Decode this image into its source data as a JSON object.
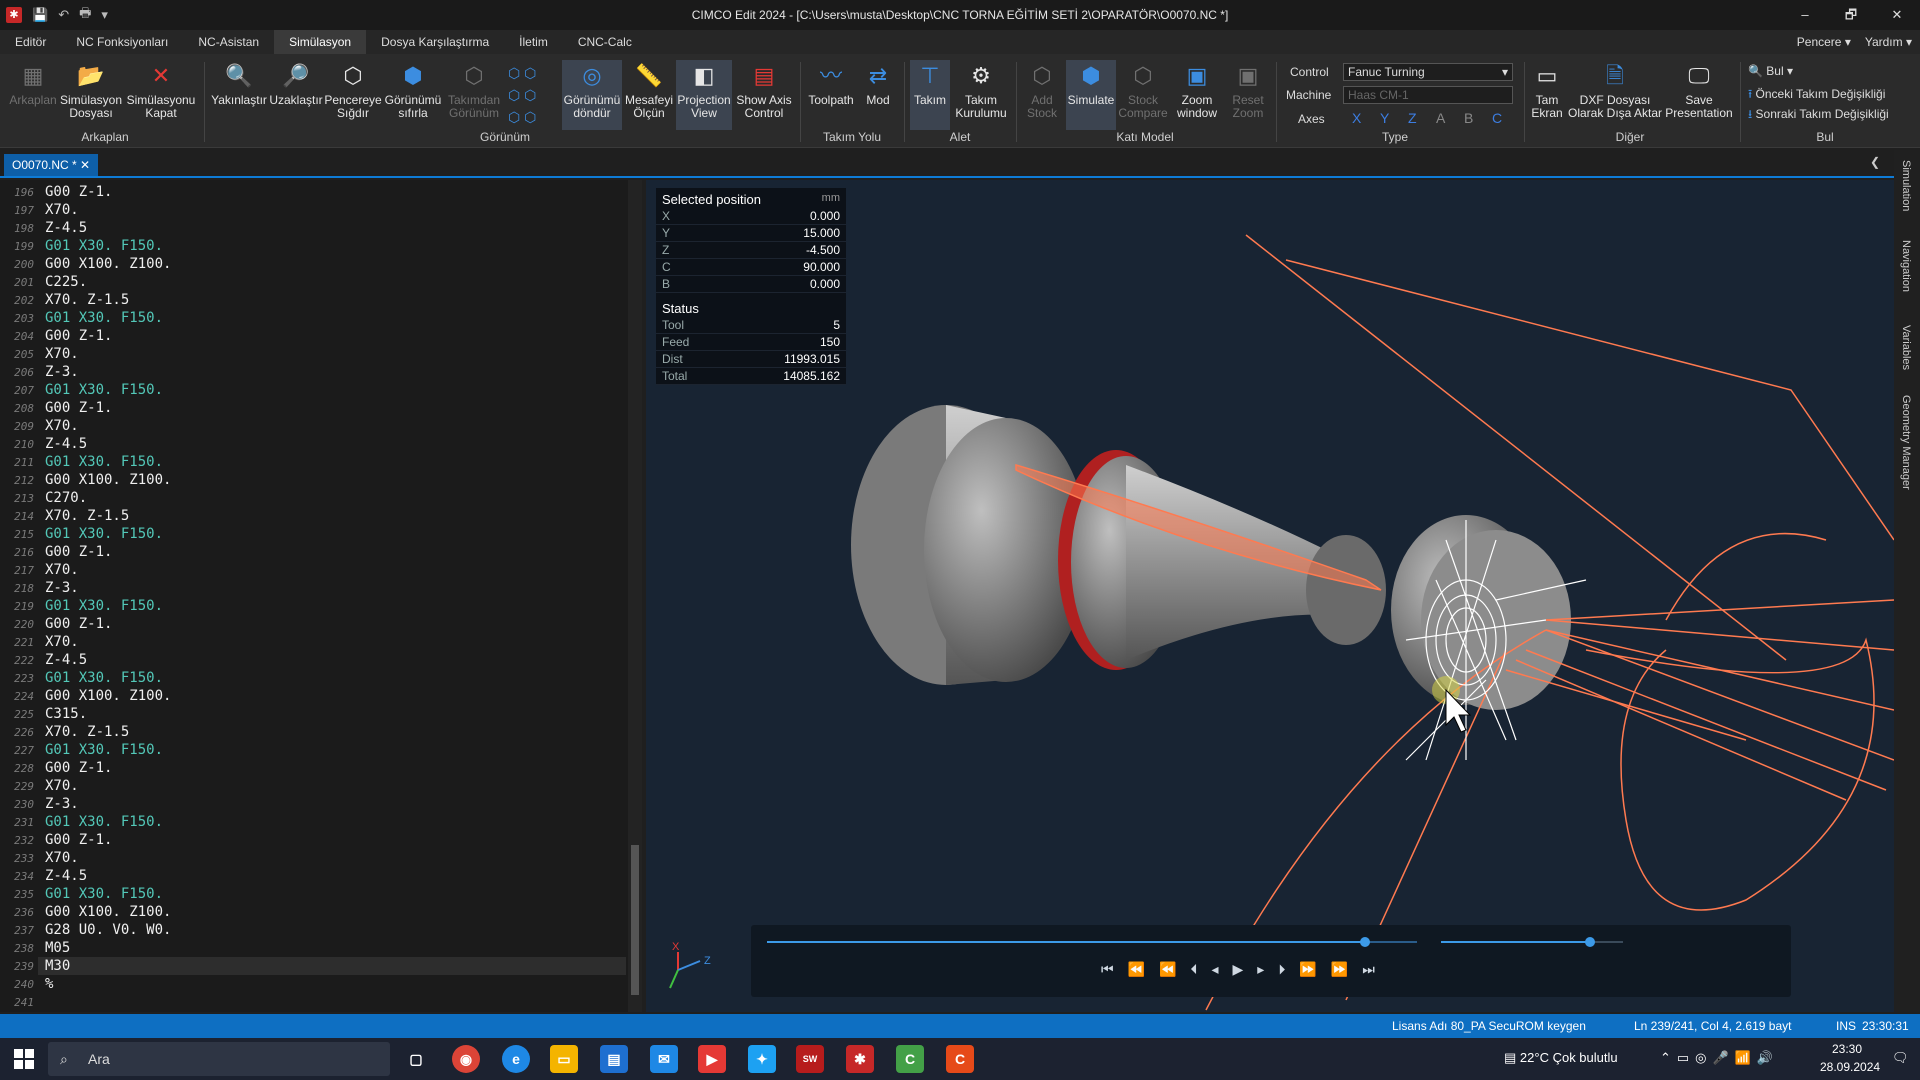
{
  "window": {
    "title": "CIMCO Edit 2024 - [C:\\Users\\musta\\Desktop\\CNC TORNA EĞİTİM SETİ 2\\OPARATÖR\\O0070.NC *]",
    "minimize": "–",
    "restore": "🗗",
    "close": "✕"
  },
  "menu": {
    "tabs": [
      "Editör",
      "NC Fonksiyonları",
      "NC-Asistan",
      "Simülasyon",
      "Dosya Karşılaştırma",
      "İletim",
      "CNC-Calc"
    ],
    "right": [
      "Pencere",
      "Yardım"
    ]
  },
  "ribbon": {
    "buttons": [
      {
        "label": "Arkaplan",
        "icon": "background-icon"
      },
      {
        "label": "Simülasyon\nDosyası",
        "icon": "folder-icon"
      },
      {
        "label": "Simülasyonu\nKapat",
        "icon": "close-icon"
      },
      {
        "label": "Yakınlaştır",
        "icon": "zoom-in-icon"
      },
      {
        "label": "Uzaklaştır",
        "icon": "zoom-out-icon"
      },
      {
        "label": "Pencereye\nSığdır",
        "icon": "fit-window-icon"
      },
      {
        "label": "Görünümü\nsıfırla",
        "icon": "reset-view-icon"
      },
      {
        "label": "Takımdan\nGörünüm",
        "icon": "tool-view-icon"
      },
      {
        "label": "Görünümü\ndöndür",
        "icon": "rotate-view-icon"
      },
      {
        "label": "Mesafeyi\nÖlçün",
        "icon": "measure-icon"
      },
      {
        "label": "Projection\nView",
        "icon": "projection-icon"
      },
      {
        "label": "Show Axis\nControl",
        "icon": "axis-control-icon"
      },
      {
        "label": "Toolpath",
        "icon": "toolpath-icon"
      },
      {
        "label": "Mod",
        "icon": "mode-icon"
      },
      {
        "label": "Takım",
        "icon": "tool-icon"
      },
      {
        "label": "Takım\nKurulumu",
        "icon": "tool-setup-icon"
      },
      {
        "label": "Add\nStock",
        "icon": "add-stock-icon"
      },
      {
        "label": "Simulate",
        "icon": "simulate-icon"
      },
      {
        "label": "Stock\nCompare",
        "icon": "stock-compare-icon"
      },
      {
        "label": "Zoom\nwindow",
        "icon": "zoom-window-icon"
      },
      {
        "label": "Reset\nZoom",
        "icon": "reset-zoom-icon"
      },
      {
        "label": "Tam\nEkran",
        "icon": "fullscreen-icon"
      },
      {
        "label": "DXF Dosyası\nOlarak Dışa Aktar",
        "icon": "dxf-icon"
      },
      {
        "label": "Save\nPresentation",
        "icon": "save-presentation-icon"
      }
    ],
    "groups": [
      "Arkaplan",
      "Görünüm",
      "Takım Yolu",
      "Alet",
      "Katı Model",
      "Type",
      "Diğer",
      "Bul"
    ],
    "control_label": "Control",
    "control_value": "Fanuc Turning",
    "machine_label": "Machine",
    "machine_value": "Haas CM-1",
    "axes_label": "Axes",
    "axes": [
      "X",
      "Y",
      "Z",
      "A",
      "B",
      "C"
    ],
    "find": "Bul",
    "prev_tool_change": "Önceki Takım Değişikliği",
    "next_tool_change": "Sonraki Takım Değişikliği"
  },
  "doc_tab": {
    "label": "O0070.NC *"
  },
  "editor": {
    "lines": [
      {
        "n": "196",
        "t": "G00 Z-1."
      },
      {
        "n": "197",
        "t": "X70."
      },
      {
        "n": "198",
        "t": "Z-4.5"
      },
      {
        "n": "199",
        "t": "G01 X30. F150."
      },
      {
        "n": "200",
        "t": "G00 X100. Z100."
      },
      {
        "n": "201",
        "t": "C225."
      },
      {
        "n": "202",
        "t": "X70. Z-1.5"
      },
      {
        "n": "203",
        "t": "G01 X30. F150."
      },
      {
        "n": "204",
        "t": "G00 Z-1."
      },
      {
        "n": "205",
        "t": "X70."
      },
      {
        "n": "206",
        "t": "Z-3."
      },
      {
        "n": "207",
        "t": "G01 X30. F150."
      },
      {
        "n": "208",
        "t": "G00 Z-1."
      },
      {
        "n": "209",
        "t": "X70."
      },
      {
        "n": "210",
        "t": "Z-4.5"
      },
      {
        "n": "211",
        "t": "G01 X30. F150."
      },
      {
        "n": "212",
        "t": "G00 X100. Z100."
      },
      {
        "n": "213",
        "t": "C270."
      },
      {
        "n": "214",
        "t": "X70. Z-1.5"
      },
      {
        "n": "215",
        "t": "G01 X30. F150."
      },
      {
        "n": "216",
        "t": "G00 Z-1."
      },
      {
        "n": "217",
        "t": "X70."
      },
      {
        "n": "218",
        "t": "Z-3."
      },
      {
        "n": "219",
        "t": "G01 X30. F150."
      },
      {
        "n": "220",
        "t": "G00 Z-1."
      },
      {
        "n": "221",
        "t": "X70."
      },
      {
        "n": "222",
        "t": "Z-4.5"
      },
      {
        "n": "223",
        "t": "G01 X30. F150."
      },
      {
        "n": "224",
        "t": "G00 X100. Z100."
      },
      {
        "n": "225",
        "t": "C315."
      },
      {
        "n": "226",
        "t": "X70. Z-1.5"
      },
      {
        "n": "227",
        "t": "G01 X30. F150."
      },
      {
        "n": "228",
        "t": "G00 Z-1."
      },
      {
        "n": "229",
        "t": "X70."
      },
      {
        "n": "230",
        "t": "Z-3."
      },
      {
        "n": "231",
        "t": "G01 X30. F150."
      },
      {
        "n": "232",
        "t": "G00 Z-1."
      },
      {
        "n": "233",
        "t": "X70."
      },
      {
        "n": "234",
        "t": "Z-4.5"
      },
      {
        "n": "235",
        "t": "G01 X30. F150."
      },
      {
        "n": "236",
        "t": "G00 X100. Z100."
      },
      {
        "n": "237",
        "t": "G28 U0. V0. W0."
      },
      {
        "n": "238",
        "t": "M05"
      },
      {
        "n": "239",
        "t": "M30"
      },
      {
        "n": "240",
        "t": "%"
      },
      {
        "n": "241",
        "t": ""
      }
    ],
    "current_line": "239"
  },
  "selected_position": {
    "title": "Selected position",
    "unit": "mm",
    "rows": [
      {
        "k": "X",
        "v": "0.000"
      },
      {
        "k": "Y",
        "v": "15.000"
      },
      {
        "k": "Z",
        "v": "-4.500"
      },
      {
        "k": "C",
        "v": "90.000"
      },
      {
        "k": "B",
        "v": "0.000"
      }
    ]
  },
  "status": {
    "title": "Status",
    "rows": [
      {
        "k": "Tool",
        "v": "5"
      },
      {
        "k": "Feed",
        "v": "150"
      },
      {
        "k": "Dist",
        "v": "11993.015"
      },
      {
        "k": "Total",
        "v": "14085.162"
      }
    ]
  },
  "side_tabs": [
    "Simulation",
    "Navigation",
    "Variables",
    "Geometry Manager"
  ],
  "playback": {
    "progress": 0.92,
    "speed": 0.82
  },
  "statusbar": {
    "license": "Lisans Adı 80_PA SecuROM keygen",
    "position": "Ln 239/241, Col 4, 2.619 bayt",
    "mode": "INS",
    "time": "23:30:31"
  },
  "taskbar": {
    "search_placeholder": "Ara",
    "weather": "22°C  Çok bulutlu",
    "clock": "23:30",
    "date": "28.09.2024"
  },
  "colors": {
    "accent": "#0e7bd6",
    "toolpath": "#ff7a50",
    "g01": "#53c8b8"
  }
}
